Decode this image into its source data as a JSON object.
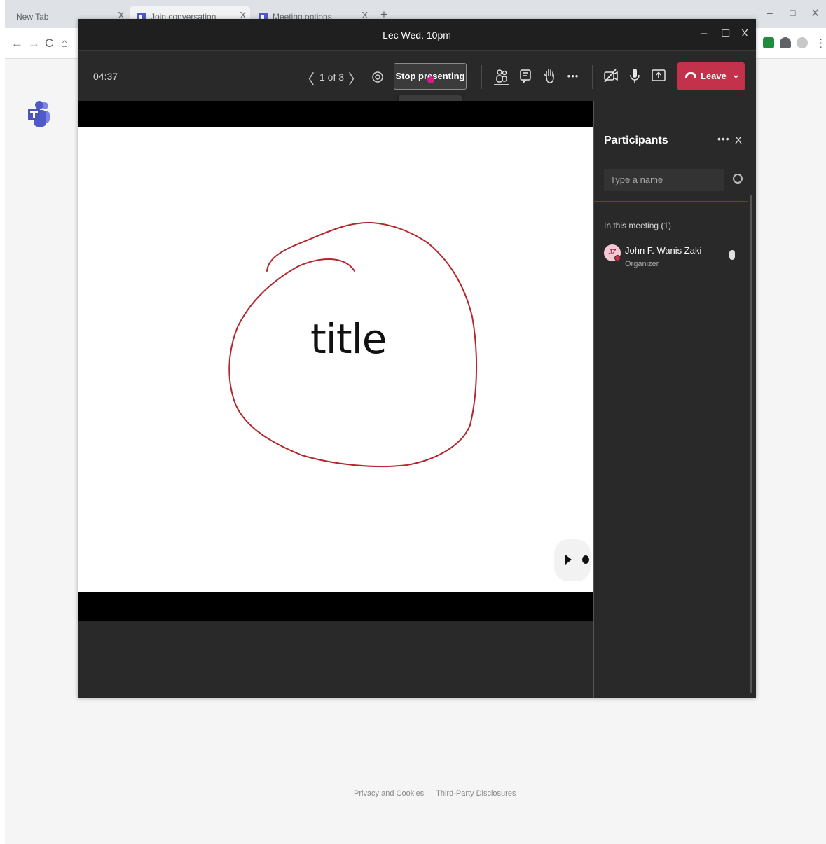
{
  "browser": {
    "tabs": [
      {
        "label": "New Tab",
        "close": "X"
      },
      {
        "label": "Join conversation",
        "close": "X"
      },
      {
        "label": "Meeting options",
        "close": "X"
      }
    ],
    "new_tab": "+",
    "window_controls": {
      "minimize": "–",
      "restore": "□",
      "close": "X"
    },
    "nav": {
      "back": "←",
      "forward": "→",
      "reload": "C",
      "home": "⌂",
      "menu": "⋮"
    }
  },
  "meeting": {
    "title": "Lec Wed. 10pm",
    "window_controls": {
      "minimize": "–",
      "maximize": "☐",
      "close": "X"
    },
    "timer": "04:37",
    "page_prev": "〈",
    "page_indicator": "1 of 3",
    "page_next": "〉",
    "stop_presenting_label": "Stop presenting",
    "tooltip": "Stop presenting",
    "more_label": "•••",
    "leave_label": "Leave",
    "leave_chevron": "⌄"
  },
  "slide": {
    "title": "title"
  },
  "participants": {
    "title": "Participants",
    "more": "•••",
    "close": "X",
    "search_placeholder": "Type a name",
    "section_label": "In this meeting (1)",
    "people": [
      {
        "initials": "JZ",
        "name": "John F. Wanis Zaki",
        "role": "Organizer"
      }
    ]
  },
  "footer": {
    "privacy": "Privacy and Cookies",
    "third_party": "Third-Party Disclosures"
  },
  "colors": {
    "leave": "#c4314b",
    "accent_teams": "#5059c9",
    "pen_ink": "#b3282d"
  }
}
